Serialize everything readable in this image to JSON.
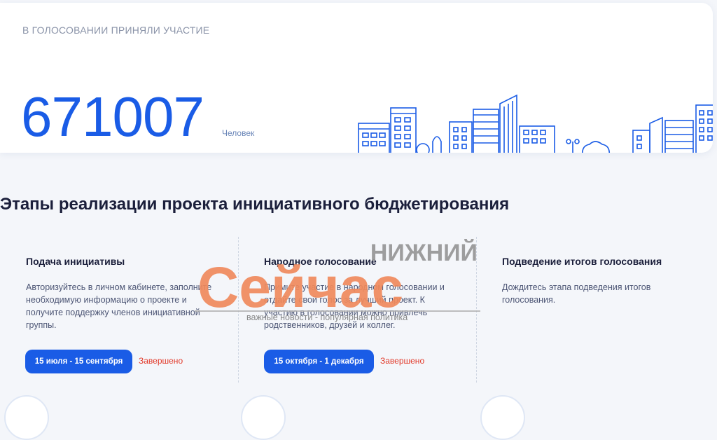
{
  "stat": {
    "label": "В ГОЛОСОВАНИИ ПРИНЯЛИ УЧАСТИЕ",
    "value": "671007",
    "unit": "Человек"
  },
  "section_title": "Этапы реализации проекта инициативного бюджетирования",
  "steps": [
    {
      "title": "Подача инициативы",
      "desc": "Авторизуйтесь в личном кабинете, заполните необходимую информацию о проекте и получите поддержку членов инициативной группы.",
      "dates": "15 июля - 15 сентября",
      "status": "Завершено"
    },
    {
      "title": "Народное голосование",
      "desc": "Примите участие в народном голосовании и отдайте свой голос за лучший проект. К участию в голосовании можно привлечь родственников, друзей и коллег.",
      "dates": "15 октября - 1 декабря",
      "status": "Завершено"
    },
    {
      "title": "Подведение итогов голосования",
      "desc": "Дождитесь этапа подведения итогов голосования."
    }
  ],
  "watermark": {
    "top": "НИЖНИЙ",
    "main": "Сейчас",
    "sub": "важные новости - популярная политика"
  },
  "colors": {
    "accent": "#1a5ce6",
    "status": "#e23a2a",
    "watermark": "#f08a5d"
  }
}
